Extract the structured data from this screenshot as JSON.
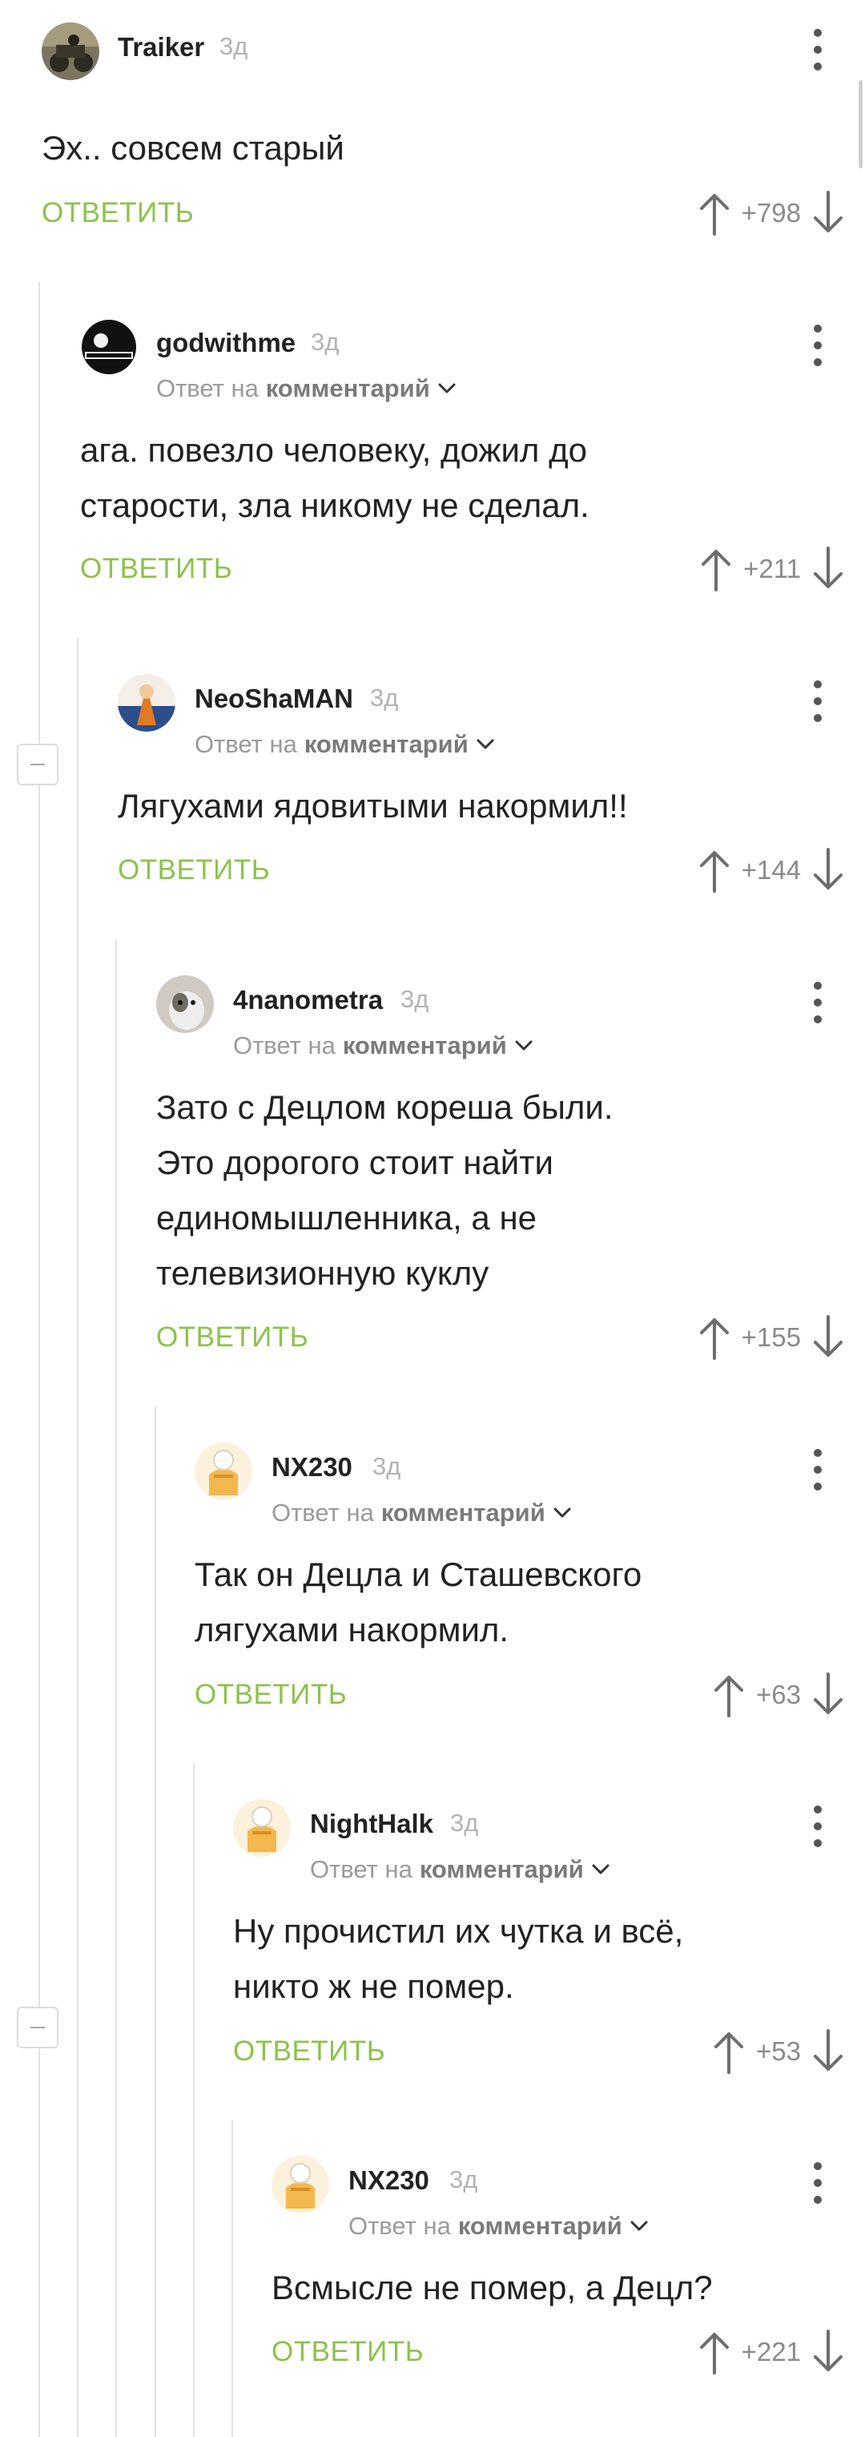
{
  "labels": {
    "reply_button": "ОТВЕТИТЬ",
    "reply_to_prefix": "Ответ на",
    "reply_to_target": "комментарий"
  },
  "comments": [
    {
      "author": "Traiker",
      "time": "3д",
      "text": "Эх.. совсем старый",
      "score": "+798",
      "is_reply": false
    },
    {
      "author": "godwithme",
      "time": "3д",
      "text": "ага. повезло человеку, дожил до\nстарости, зла никому не сделал.",
      "score": "+211",
      "is_reply": true
    },
    {
      "author": "NeoShaMAN",
      "time": "3д",
      "text": "Лягухами ядовитыми накормил!!",
      "score": "+144",
      "is_reply": true
    },
    {
      "author": "4nanometra",
      "time": "3д",
      "text": "Зато с Децлом кореша были.\nЭто дорогого стоит найти\nединомышленника, а не\nтелевизионную куклу",
      "score": "+155",
      "is_reply": true
    },
    {
      "author": "NX230",
      "time": "3д",
      "text": "Так он Децла и Сташевского\nлягухами накормил.",
      "score": "+63",
      "is_reply": true
    },
    {
      "author": "NightHalk",
      "time": "3д",
      "text": "Ну прочистил их чутка и всё,\nникто ж не помер.",
      "score": "+53",
      "is_reply": true
    },
    {
      "author": "NX230",
      "time": "3д",
      "text": "Всмысле не помер, а Децл?",
      "score": "+221",
      "is_reply": true
    }
  ],
  "colors": {
    "reply_green": "#8bc34a",
    "thread_line": "#e3e3e3",
    "muted_text": "#9a9a9a"
  },
  "icons": [
    "vertical-dots-icon",
    "arrow-up-icon",
    "arrow-down-icon",
    "chevron-down-icon",
    "collapse-minus-icon"
  ]
}
